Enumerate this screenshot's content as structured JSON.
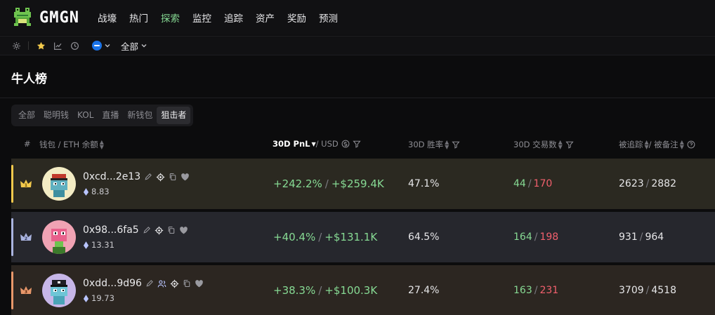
{
  "app": {
    "brand": "GMGN"
  },
  "nav": [
    {
      "label": "战壕",
      "active": false
    },
    {
      "label": "热门",
      "active": false
    },
    {
      "label": "探索",
      "active": true
    },
    {
      "label": "监控",
      "active": false
    },
    {
      "label": "追踪",
      "active": false
    },
    {
      "label": "资产",
      "active": false
    },
    {
      "label": "奖励",
      "active": false
    },
    {
      "label": "预测",
      "active": false
    }
  ],
  "toolbar": {
    "chain_icon": "ethereum-chain-icon",
    "scope_label": "全部"
  },
  "page": {
    "title": "牛人榜"
  },
  "tabs": [
    {
      "label": "全部",
      "active": false
    },
    {
      "label": "聪明钱",
      "active": false
    },
    {
      "label": "KOL",
      "active": false
    },
    {
      "label": "直播",
      "active": false
    },
    {
      "label": "新钱包",
      "active": false
    },
    {
      "label": "狙击者",
      "active": true
    }
  ],
  "table": {
    "headers": {
      "rank": "#",
      "wallet": "钱包 / ETH 余额",
      "pnl_strong": "30D PnL",
      "pnl_rest": " / USD",
      "winrate": "30D 胜率",
      "txs": "30D 交易数",
      "follow_a": "被追踪",
      "follow_b": " / 被备注"
    },
    "rows": [
      {
        "rank": "1",
        "address": "0xcd...2e13",
        "balance": "8.83",
        "pnl_pct": "+242.2%",
        "pnl_usd": "+$259.4K",
        "winrate": "47.1%",
        "buys": "44",
        "sells": "170",
        "tracked": "2623",
        "noted": "2882"
      },
      {
        "rank": "2",
        "address": "0x98...6fa5",
        "balance": "13.31",
        "pnl_pct": "+40.4%",
        "pnl_usd": "+$131.1K",
        "winrate": "64.5%",
        "buys": "164",
        "sells": "198",
        "tracked": "931",
        "noted": "964"
      },
      {
        "rank": "3",
        "address": "0xdd...9d96",
        "balance": "19.73",
        "pnl_pct": "+38.3%",
        "pnl_usd": "+$100.3K",
        "winrate": "27.4%",
        "buys": "163",
        "sells": "231",
        "tracked": "3709",
        "noted": "4518"
      }
    ]
  },
  "colors": {
    "accent_green": "#86d993",
    "sell_red": "#f2606d",
    "rank1": "#f2c94c",
    "rank2": "#aab4e0",
    "rank3": "#e8976a"
  }
}
